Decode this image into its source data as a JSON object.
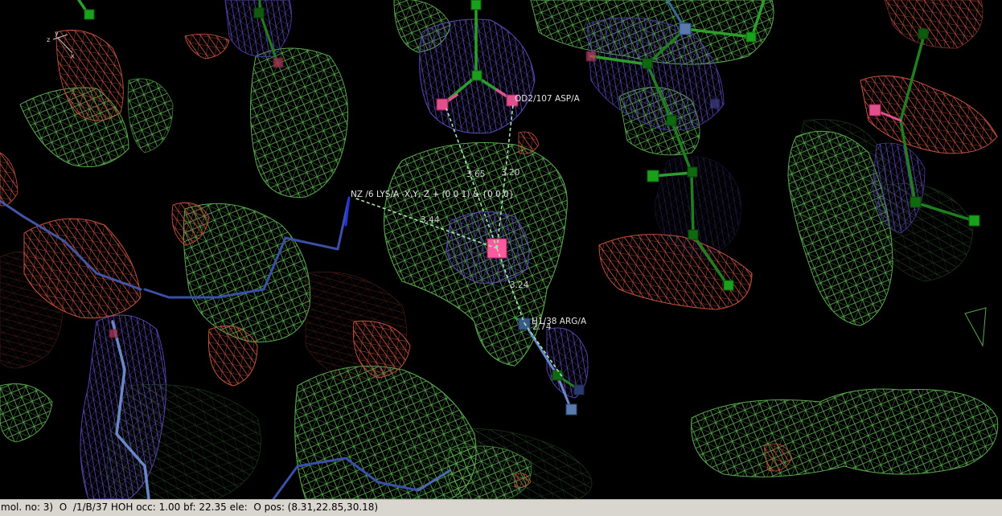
{
  "viewer": {
    "labels": {
      "asp": "OD2/107 ASP/A",
      "lys": "NZ /6 LYS/A  -X,Y,-Z + (0 0 1) & {0 0 0}",
      "arg": "H1/38 ARG/A"
    },
    "distances": {
      "d1": "3.65",
      "d2": "3.20",
      "d3": "3.44",
      "d4": "3.24",
      "d5": "2.74"
    },
    "axes": {
      "x": "x",
      "y": "y",
      "z": "z"
    },
    "colors": {
      "map_green": "#5aa84f",
      "map_blue": "#5a46b4",
      "map_red": "#c4503f",
      "bond_green": "#2aa02a",
      "bond_blue": "#6a88c8",
      "oxygen": "#e0508a",
      "water": "#ff5aa0",
      "distance": "#a8e8b0"
    }
  },
  "statusbar": {
    "text": "mol. no: 3)  O  /1/B/37 HOH occ: 1.00 bf: 22.35 ele:  O pos: (8.31,22.85,30.18)"
  }
}
